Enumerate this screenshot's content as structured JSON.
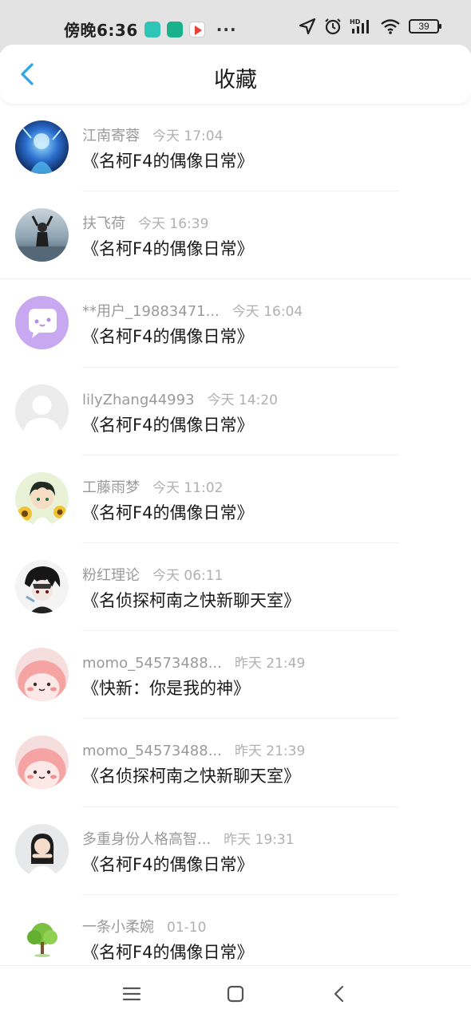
{
  "status_bar": {
    "time": "傍晚6:36",
    "more": "···",
    "battery": "39",
    "icons": [
      "location-icon",
      "alarm-icon",
      "hd-signal-icon",
      "wifi-icon",
      "battery-icon"
    ]
  },
  "header": {
    "title": "收藏",
    "back_icon": "chevron-left-icon",
    "accent_color": "#2aa6e8"
  },
  "items": [
    {
      "user": "江南寄蓉",
      "time": "今天 17:04",
      "title": "《名柯F4的偶像日常》",
      "avatar": "anime-blue-avatar"
    },
    {
      "user": "扶飞荷",
      "time": "今天 16:39",
      "title": "《名柯F4的偶像日常》",
      "avatar": "beach-girl-avatar"
    },
    {
      "user": "**用户_19883471...",
      "time": "今天 16:04",
      "title": "《名柯F4的偶像日常》",
      "avatar": "chat-bubble-avatar"
    },
    {
      "user": "lilyZhang44993",
      "time": "今天 14:20",
      "title": "《名柯F4的偶像日常》",
      "avatar": "default-user-avatar"
    },
    {
      "user": "工藤雨梦",
      "time": "今天 11:02",
      "title": "《名柯F4的偶像日常》",
      "avatar": "anime-boy-sunflower-avatar"
    },
    {
      "user": "粉红理论",
      "time": "今天 06:11",
      "title": "《名侦探柯南之快新聊天室》",
      "avatar": "anime-dark-avatar"
    },
    {
      "user": "momo_54573488...",
      "time": "昨天 21:49",
      "title": "《快新：你是我的神》",
      "avatar": "pink-blob-avatar"
    },
    {
      "user": "momo_54573488...",
      "time": "昨天 21:39",
      "title": "《名侦探柯南之快新聊天室》",
      "avatar": "pink-blob-avatar"
    },
    {
      "user": "多重身份人格高智...",
      "time": "昨天 19:31",
      "title": "《名柯F4的偶像日常》",
      "avatar": "girl-photo-avatar"
    },
    {
      "user": "一条小柔婉",
      "time": "01-10",
      "title": "《名柯F4的偶像日常》",
      "avatar": "tree-avatar"
    }
  ],
  "nav": {
    "menu_icon": "menu-icon",
    "home_icon": "home-square-icon",
    "back_icon": "back-triangle-icon"
  }
}
